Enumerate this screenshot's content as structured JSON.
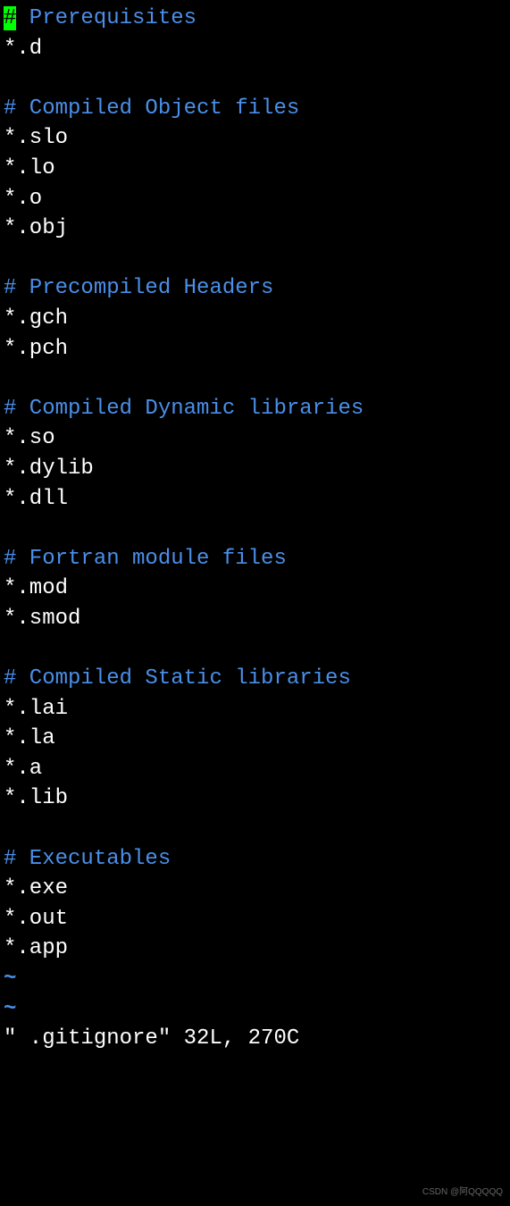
{
  "editor": {
    "cursor_char": "#",
    "sections": [
      {
        "comment": " Prerequisites",
        "patterns": [
          "*.d"
        ],
        "has_cursor": true
      },
      {
        "comment": "# Compiled Object files",
        "patterns": [
          "*.slo",
          "*.lo",
          "*.o",
          "*.obj"
        ],
        "has_cursor": false
      },
      {
        "comment": "# Precompiled Headers",
        "patterns": [
          "*.gch",
          "*.pch"
        ],
        "has_cursor": false
      },
      {
        "comment": "# Compiled Dynamic libraries",
        "patterns": [
          "*.so",
          "*.dylib",
          "*.dll"
        ],
        "has_cursor": false
      },
      {
        "comment": "# Fortran module files",
        "patterns": [
          "*.mod",
          "*.smod"
        ],
        "has_cursor": false
      },
      {
        "comment": "# Compiled Static libraries",
        "patterns": [
          "*.lai",
          "*.la",
          "*.a",
          "*.lib"
        ],
        "has_cursor": false
      },
      {
        "comment": "# Executables",
        "patterns": [
          "*.exe",
          "*.out",
          "*.app"
        ],
        "has_cursor": false
      }
    ],
    "empty_lines": [
      "~",
      "~"
    ],
    "status_line": "\" .gitignore\" 32L, 270C",
    "watermark": "CSDN @阿QQQQQ"
  }
}
